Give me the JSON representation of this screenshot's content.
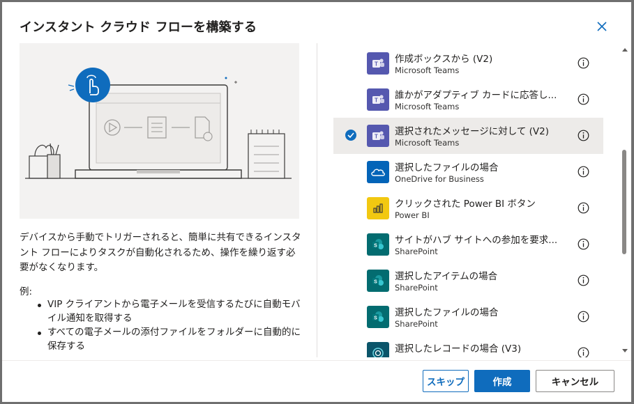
{
  "dialog": {
    "title": "インスタント クラウド フローを構築する",
    "close_icon": "close-icon"
  },
  "left": {
    "description": "デバイスから手動でトリガーされると、簡単に共有できるインスタント フローによりタスクが自動化されるため、操作を繰り返す必要がなくなります。",
    "example_label": "例:",
    "examples": [
      "VIP クライアントから電子メールを受信するたびに自動モバイル通知を取得する",
      "すべての電子メールの添付ファイルをフォルダーに自動的に保存する"
    ]
  },
  "triggers": [
    {
      "name": "作成ボックスから (V2)",
      "connector": "Microsoft Teams",
      "icon": "teams-icon",
      "selected": false
    },
    {
      "name": "誰かがアダプティブ カードに応答し...",
      "connector": "Microsoft Teams",
      "icon": "teams-icon",
      "selected": false
    },
    {
      "name": "選択されたメッセージに対して (V2)",
      "connector": "Microsoft Teams",
      "icon": "teams-icon",
      "selected": true
    },
    {
      "name": "選択したファイルの場合",
      "connector": "OneDrive for Business",
      "icon": "onedrive-icon",
      "selected": false
    },
    {
      "name": "クリックされた Power BI ボタン",
      "connector": "Power BI",
      "icon": "powerbi-icon",
      "selected": false
    },
    {
      "name": "サイトがハブ サイトへの参加を要求...",
      "connector": "SharePoint",
      "icon": "sharepoint-icon",
      "selected": false
    },
    {
      "name": "選択したアイテムの場合",
      "connector": "SharePoint",
      "icon": "sharepoint-icon",
      "selected": false
    },
    {
      "name": "選択したファイルの場合",
      "connector": "SharePoint",
      "icon": "sharepoint-icon",
      "selected": false
    },
    {
      "name": "選択したレコードの場合 (V3)",
      "connector": "",
      "icon": "dataverse-icon",
      "selected": false
    }
  ],
  "footer": {
    "skip_label": "スキップ",
    "create_label": "作成",
    "cancel_label": "キャンセル"
  },
  "colors": {
    "accent": "#0f6cbd",
    "teams": "#5558af",
    "onedrive": "#0364b8",
    "powerbi": "#f2c811",
    "sharepoint": "#036c70",
    "dataverse": "#0b556a"
  }
}
